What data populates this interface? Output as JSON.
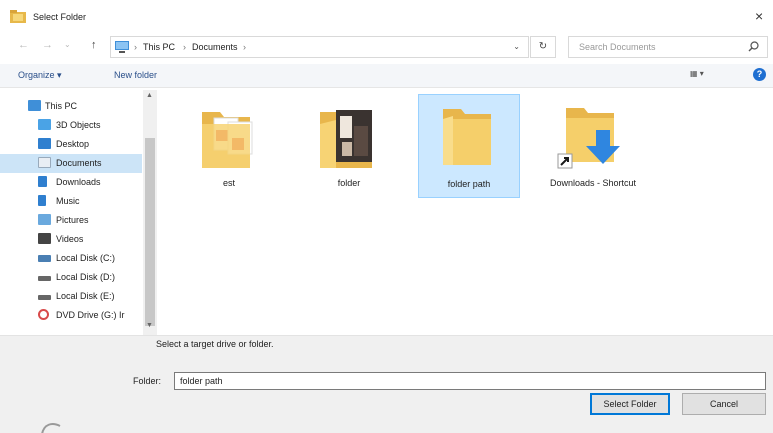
{
  "window": {
    "title": "Select Folder",
    "close_glyph": "×"
  },
  "nav": {
    "back_glyph": "←",
    "forward_glyph": "→",
    "recent_glyph": "⌄",
    "up_glyph": "↑",
    "breadcrumb": [
      "This PC",
      "Documents"
    ],
    "crumb_separator": "›",
    "address_dropdown_glyph": "⌄",
    "refresh_glyph": "↻",
    "search_placeholder": "Search Documents"
  },
  "toolbar": {
    "organize_label": "Organize ▾",
    "new_folder_label": "New folder",
    "view_glyph": "▦ ▾",
    "help_glyph": "?"
  },
  "sidebar": {
    "items": [
      {
        "label": "This PC",
        "icon": "pc-icon"
      },
      {
        "label": "3D Objects",
        "icon": "cube-icon"
      },
      {
        "label": "Desktop",
        "icon": "desktop-icon"
      },
      {
        "label": "Documents",
        "icon": "documents-icon"
      },
      {
        "label": "Downloads",
        "icon": "download-icon"
      },
      {
        "label": "Music",
        "icon": "music-icon"
      },
      {
        "label": "Pictures",
        "icon": "pictures-icon"
      },
      {
        "label": "Videos",
        "icon": "videos-icon"
      },
      {
        "label": "Local Disk (C:)",
        "icon": "disk-icon"
      },
      {
        "label": "Local Disk (D:)",
        "icon": "disk-icon"
      },
      {
        "label": "Local Disk (E:)",
        "icon": "disk-icon"
      },
      {
        "label": "DVD Drive (G:) Ir",
        "icon": "dvd-icon"
      }
    ],
    "selected": "Documents"
  },
  "content": {
    "items": [
      {
        "label": "est",
        "icon": "folder-pdf-icon"
      },
      {
        "label": "folder",
        "icon": "folder-photo-icon"
      },
      {
        "label": "folder path",
        "icon": "folder-icon"
      },
      {
        "label": "Downloads - Shortcut",
        "icon": "folder-shortcut-icon"
      }
    ],
    "selected": "folder path"
  },
  "footer": {
    "hint": "Select a target drive or folder.",
    "folder_label": "Folder:",
    "folder_value": "folder path",
    "select_button": "Select Folder",
    "cancel_button": "Cancel"
  },
  "colors": {
    "selection": "#cce8ff",
    "link": "#2a4f8a",
    "folder": "#f5cf6a",
    "accent": "#0078d7"
  }
}
